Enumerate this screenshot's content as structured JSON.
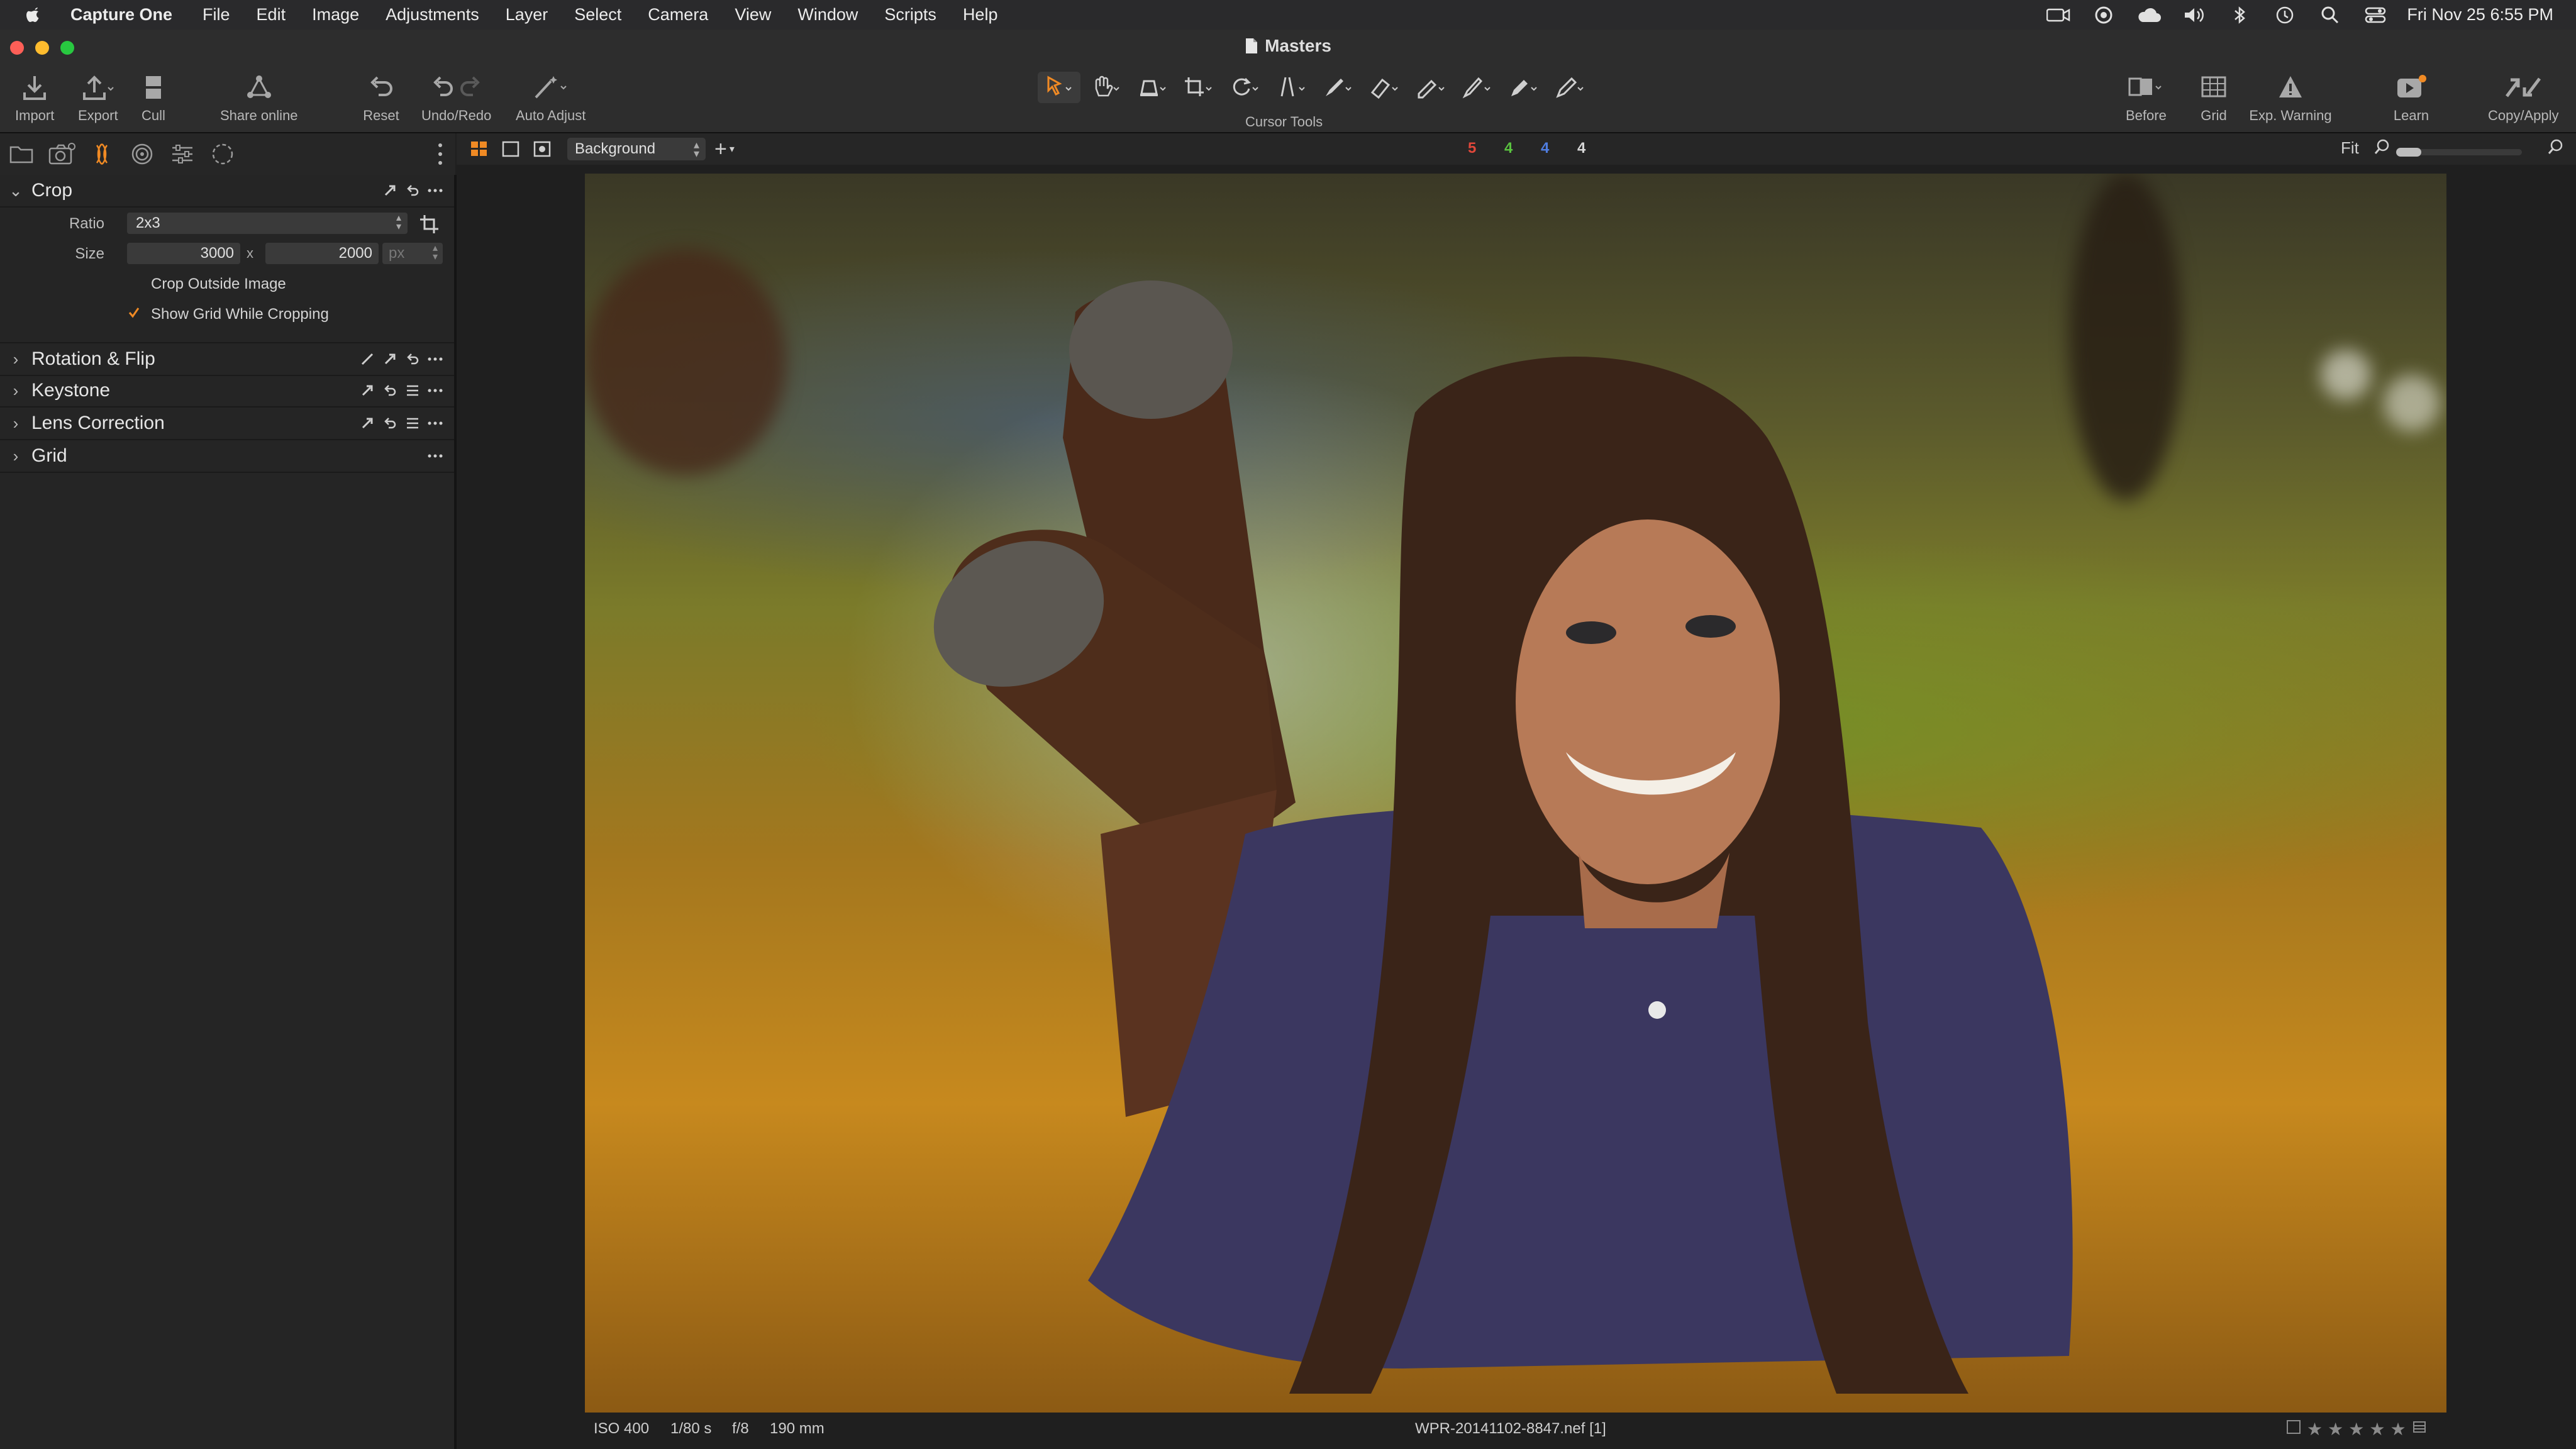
{
  "menubar": {
    "app_name": "Capture One",
    "items": [
      "File",
      "Edit",
      "Image",
      "Adjustments",
      "Layer",
      "Select",
      "Camera",
      "View",
      "Window",
      "Scripts",
      "Help"
    ],
    "clock": "Fri Nov 25  6:55 PM"
  },
  "window": {
    "title": "Masters"
  },
  "toolbar": {
    "import": "Import",
    "export": "Export",
    "cull": "Cull",
    "share": "Share online",
    "reset": "Reset",
    "undo_redo": "Undo/Redo",
    "auto_adjust": "Auto Adjust",
    "cursor_tools": "Cursor Tools",
    "before": "Before",
    "grid": "Grid",
    "exp_warning": "Exp. Warning",
    "learn": "Learn",
    "copy_apply": "Copy/Apply"
  },
  "viewer_bar": {
    "layer": "Background",
    "counts": [
      {
        "value": "5",
        "color": "#e0473a"
      },
      {
        "value": "4",
        "color": "#59c23f"
      },
      {
        "value": "4",
        "color": "#4f7de0"
      },
      {
        "value": "4",
        "color": "#d6d6d6"
      }
    ],
    "zoom": "Fit"
  },
  "panel": {
    "crop": {
      "title": "Crop",
      "ratio_label": "Ratio",
      "ratio_value": "2x3",
      "size_label": "Size",
      "width": "3000",
      "times": "x",
      "height": "2000",
      "unit": "px",
      "crop_outside": "Crop Outside Image",
      "crop_outside_checked": false,
      "show_grid": "Show Grid While Cropping",
      "show_grid_checked": true
    },
    "rotation": "Rotation & Flip",
    "keystone": "Keystone",
    "lens": "Lens Correction",
    "grid": "Grid"
  },
  "status": {
    "iso": "ISO 400",
    "shutter": "1/80 s",
    "aperture": "f/8",
    "focal": "190 mm",
    "filename": "WPR-20141102-8847.nef [1]",
    "rating": 0,
    "max_rating": 5
  },
  "colors": {
    "accent_orange": "#f08a24",
    "background": "#1f1f1f",
    "panel": "#252525"
  }
}
